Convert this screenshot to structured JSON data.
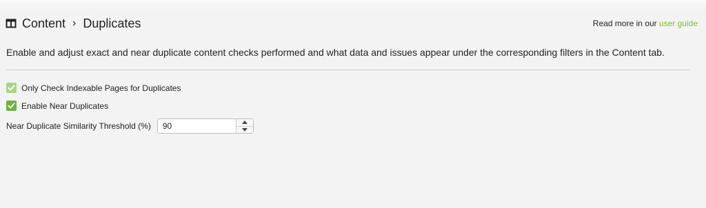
{
  "header": {
    "icon": "panel-columns-icon",
    "breadcrumb": [
      "Content",
      "Duplicates"
    ],
    "separator": "›",
    "read_more_prefix": "Read more in our",
    "user_guide_link": "user guide"
  },
  "description": "Enable and adjust exact and near duplicate content checks performed and what data and issues appear under the corresponding filters in the Content tab.",
  "options": [
    {
      "label": "Only Check Indexable Pages for Duplicates",
      "checked": true,
      "enabled": false
    },
    {
      "label": "Enable Near Duplicates",
      "checked": true,
      "enabled": true
    }
  ],
  "threshold": {
    "label": "Near Duplicate Similarity Threshold (%)",
    "value": "90"
  },
  "colors": {
    "accent": "#7cbf2a",
    "checkbox_enabled": "#6db33f",
    "checkbox_disabled": "#a8d684"
  }
}
